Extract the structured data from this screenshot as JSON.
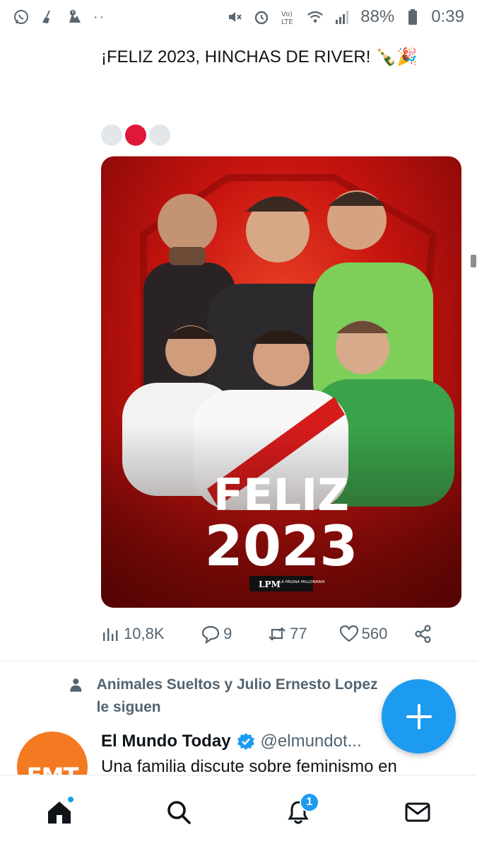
{
  "status_bar": {
    "battery": "88%",
    "time": "0:39",
    "left_icons": [
      "whatsapp-icon",
      "broom-icon",
      "storage-alert-icon",
      "more-dots"
    ],
    "right_icons": [
      "mute-icon",
      "alarm-icon",
      "volte-icon",
      "wifi-icon",
      "signal-icon",
      "battery-icon"
    ]
  },
  "tweet": {
    "text": "¡FELIZ 2023, HINCHAS DE RIVER! 🍾🎉",
    "carousel": {
      "count": 3,
      "active_index": 1
    },
    "image": {
      "headline_line1": "FELIZ",
      "headline_line2": "2023",
      "brand_mark": "LPM",
      "brand_name": "LA PÁGINA MILLONARIA"
    },
    "actions": {
      "views": "10,8K",
      "replies": "9",
      "retweets": "77",
      "likes": "560"
    }
  },
  "follow_context": {
    "text": "Animales Sueltos y Julio Ernesto Lopez le siguen"
  },
  "next_tweet": {
    "avatar_text": "EMT",
    "name": "El Mundo Today",
    "handle": "@elmundot...",
    "body": "Una familia discute sobre feminismo en"
  },
  "bottom_nav": {
    "notifications_badge": "1",
    "items": [
      "home",
      "search",
      "notifications",
      "messages"
    ]
  },
  "colors": {
    "accent": "#1d9bf0",
    "carousel_active": "#e0163a",
    "muted": "#536471",
    "avatar_orange": "#f47a22"
  }
}
